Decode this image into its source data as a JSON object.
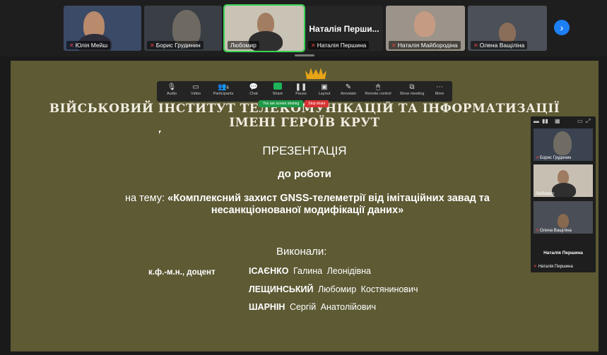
{
  "gallery": {
    "tiles": [
      {
        "name": "Юлія Мейш"
      },
      {
        "name": "Борис Грудинин"
      },
      {
        "name": "Любомир"
      },
      {
        "name": "Наталія Першина",
        "big_name": "Наталія Перши..."
      },
      {
        "name": "Наталія Майбородіна"
      },
      {
        "name": "Олена Ващіліна"
      }
    ],
    "next_icon": "chevron-right-icon"
  },
  "toolbar": {
    "buttons": [
      {
        "label": "Audio",
        "icon": "microphone-icon"
      },
      {
        "label": "Video",
        "icon": "camera-icon"
      },
      {
        "label": "Participants",
        "icon": "participants-icon",
        "count": "6"
      },
      {
        "label": "Chat",
        "icon": "chat-icon"
      },
      {
        "label": "Share",
        "icon": "share-icon"
      },
      {
        "label": "Pause",
        "icon": "pause-icon"
      },
      {
        "label": "Layout",
        "icon": "layout-icon"
      },
      {
        "label": "Annotate",
        "icon": "pencil-icon"
      },
      {
        "label": "Remote control",
        "icon": "mouse-icon"
      },
      {
        "label": "Show meeting",
        "icon": "window-icon"
      },
      {
        "label": "More",
        "icon": "more-icon"
      }
    ],
    "sharing_status": "You are screen sharing",
    "stop_share": "Stop share"
  },
  "slide": {
    "institute_line1": "ВІЙСЬКОВИЙ ІНСТИТУТ ТЕЛЕКОМУНІКАЦІЙ ТА ІНФОРМАТИЗАЦІЇ",
    "institute_line2": "ІМЕНІ ГЕРОЇВ КРУТ",
    "presentation": "ПРЕЗЕНТАЦІЯ",
    "to_work": "до роботи",
    "theme_lead": "на тему: ",
    "theme_title": "«Комплексний захист GNSS-телеметрії від імітаційних завад та несанкціонованої модифікації даних»",
    "performed_by": "Виконали:",
    "rank": "к.ф.-м.н., доцент",
    "authors": [
      {
        "surname": "ІСАЄНКО",
        "name": "Галина  Леонідівна"
      },
      {
        "surname": "ЛЕЩИНСЬКИЙ",
        "name": "Любомир  Костянинович"
      },
      {
        "surname": "ШАРНІН",
        "name": "Сергій  Анатолійович"
      }
    ]
  },
  "panel": {
    "tiles": [
      {
        "name": "Борис Грудинин"
      },
      {
        "name": "Любомир"
      },
      {
        "name": "Олена Ващіліна"
      }
    ],
    "self_name": "Наталія Першина",
    "self_label": "Наталія Першина"
  }
}
